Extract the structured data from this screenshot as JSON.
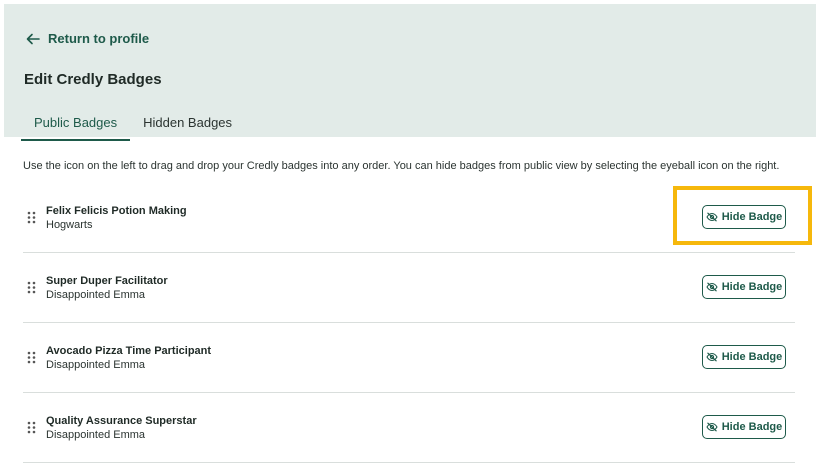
{
  "header": {
    "back_label": "Return to profile",
    "title": "Edit Credly Badges",
    "tabs": [
      {
        "label": "Public Badges",
        "active": true
      },
      {
        "label": "Hidden Badges",
        "active": false
      }
    ]
  },
  "intro": "Use the icon on the left to drag and drop your Credly badges into any order. You can hide badges from public view by selecting the eyeball icon on the right.",
  "badges": [
    {
      "title": "Felix Felicis Potion Making",
      "issuer": "Hogwarts",
      "button_label": "Hide Badge",
      "highlighted": true
    },
    {
      "title": "Super Duper Facilitator",
      "issuer": "Disappointed Emma",
      "button_label": "Hide Badge",
      "highlighted": false
    },
    {
      "title": "Avocado Pizza Time Participant",
      "issuer": "Disappointed Emma",
      "button_label": "Hide Badge",
      "highlighted": false
    },
    {
      "title": "Quality Assurance Superstar",
      "issuer": "Disappointed Emma",
      "button_label": "Hide Badge",
      "highlighted": false
    }
  ],
  "colors": {
    "accent": "#1e5a4a",
    "header_bg": "#e2ebe8",
    "highlight": "#f6b80c"
  }
}
